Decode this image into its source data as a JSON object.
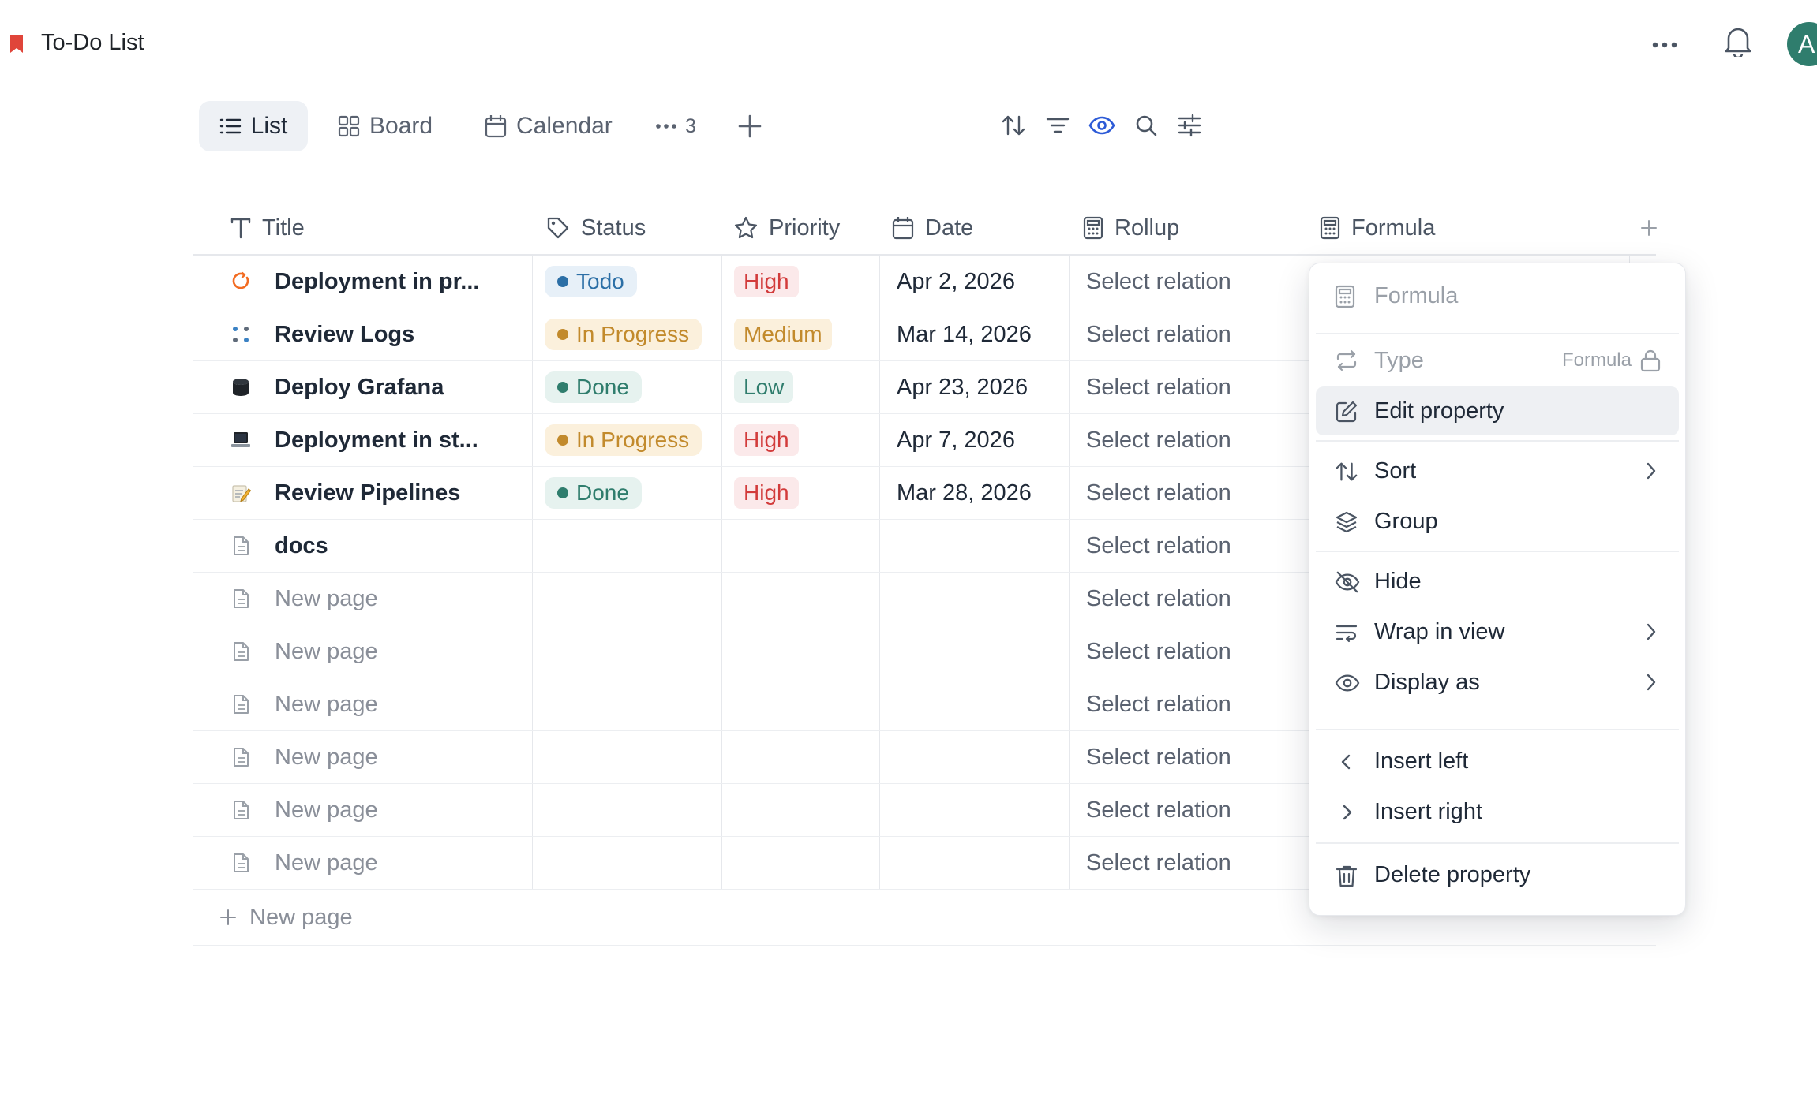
{
  "header": {
    "title": "To-Do List",
    "bookmark_color": "#e0453a",
    "avatar_initial": "A",
    "avatar_color": "#2f7d6d"
  },
  "views": {
    "tabs": [
      {
        "label": "List",
        "icon": "list-icon",
        "active": true
      },
      {
        "label": "Board",
        "icon": "board-icon"
      },
      {
        "label": "Calendar",
        "icon": "calendar-icon"
      }
    ],
    "more_count": "3"
  },
  "table": {
    "columns": [
      {
        "label": "Title",
        "icon": "text-type-icon"
      },
      {
        "label": "Status",
        "icon": "tag-icon"
      },
      {
        "label": "Priority",
        "icon": "star-icon"
      },
      {
        "label": "Date",
        "icon": "calendar-icon"
      },
      {
        "label": "Rollup",
        "icon": "calculator-icon"
      },
      {
        "label": "Formula",
        "icon": "calculator-icon"
      }
    ],
    "rows": [
      {
        "title": "Deployment in pr...",
        "icon": "spinner-emoji",
        "status": "Todo",
        "priority": "High",
        "date": "Apr 2, 2026",
        "rollup": "Select relation"
      },
      {
        "title": "Review Logs",
        "icon": "dots-emoji",
        "status": "In Progress",
        "priority": "Medium",
        "date": "Mar 14, 2026",
        "rollup": "Select relation"
      },
      {
        "title": "Deploy Grafana",
        "icon": "database-emoji",
        "status": "Done",
        "priority": "Low",
        "date": "Apr 23, 2026",
        "rollup": "Select relation"
      },
      {
        "title": "Deployment in st...",
        "icon": "laptop-emoji",
        "status": "In Progress",
        "priority": "High",
        "date": "Apr 7, 2026",
        "rollup": "Select relation"
      },
      {
        "title": "Review Pipelines",
        "icon": "memo-emoji",
        "status": "Done",
        "priority": "High",
        "date": "Mar 28, 2026",
        "rollup": "Select relation"
      },
      {
        "title": "docs",
        "icon": "page-icon",
        "status": "",
        "priority": "",
        "date": "",
        "rollup": "Select relation"
      },
      {
        "title": "New page",
        "icon": "page-icon",
        "status": "",
        "priority": "",
        "date": "",
        "rollup": "Select relation"
      },
      {
        "title": "New page",
        "icon": "page-icon",
        "status": "",
        "priority": "",
        "date": "",
        "rollup": "Select relation"
      },
      {
        "title": "New page",
        "icon": "page-icon",
        "status": "",
        "priority": "",
        "date": "",
        "rollup": "Select relation"
      },
      {
        "title": "New page",
        "icon": "page-icon",
        "status": "",
        "priority": "",
        "date": "",
        "rollup": "Select relation"
      },
      {
        "title": "New page",
        "icon": "page-icon",
        "status": "",
        "priority": "",
        "date": "",
        "rollup": "Select relation"
      },
      {
        "title": "New page",
        "icon": "page-icon",
        "status": "",
        "priority": "",
        "date": "",
        "rollup": "Select relation"
      }
    ],
    "new_row_label": "New page"
  },
  "menu": {
    "header": "Formula",
    "type_label": "Type",
    "type_value": "Formula",
    "edit_property": "Edit property",
    "sort": "Sort",
    "group": "Group",
    "hide": "Hide",
    "wrap_in_view": "Wrap in view",
    "display_as": "Display as",
    "insert_left": "Insert left",
    "insert_right": "Insert right",
    "delete_property": "Delete property"
  },
  "colors": {
    "accent_eye": "#2d5bd7",
    "status_todo": "#2c6fa6",
    "status_in_progress": "#c28a2c",
    "status_done": "#2f7d6d",
    "priority_high": "#d23b3b"
  }
}
